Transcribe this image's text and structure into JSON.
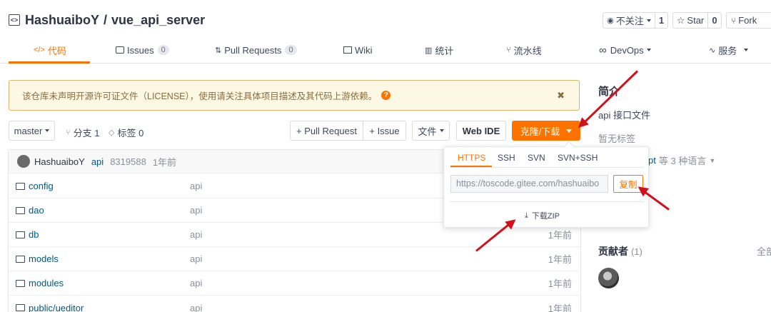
{
  "repo": {
    "owner": "HashuaiboY",
    "separator": "/",
    "name": "vue_api_server",
    "watch_label": "不关注",
    "watch_count": "1",
    "star_label": "Star",
    "star_count": "0",
    "fork_label": "Fork"
  },
  "tabs": [
    {
      "label": "代码",
      "icon": "code-icon"
    },
    {
      "label": "Issues",
      "count": "0",
      "icon": "issues-icon"
    },
    {
      "label": "Pull Requests",
      "count": "0",
      "icon": "pull-request-icon"
    },
    {
      "label": "Wiki",
      "icon": "wiki-icon"
    },
    {
      "label": "统计",
      "icon": "stats-icon"
    },
    {
      "label": "流水线",
      "icon": "pipeline-icon"
    },
    {
      "label": "DevOps",
      "icon": "infinity-icon"
    },
    {
      "label": "服务",
      "icon": "pulse-icon"
    }
  ],
  "notice": {
    "text": "该仓库未声明开源许可证文件（LICENSE），使用请关注具体项目描述及其代码上游依赖。",
    "help": "?",
    "close": "✖"
  },
  "toolbar": {
    "branch": "master",
    "branches": "分支 1",
    "tags": "标签 0",
    "pull_request": "+ Pull Request",
    "issue": "+ Issue",
    "file": "文件",
    "web_ide": "Web IDE",
    "clone": "克隆/下载"
  },
  "commit": {
    "author": "HashuaiboY",
    "message": "api",
    "hash": "8319588",
    "time": "1年前"
  },
  "files": [
    {
      "name": "config",
      "msg": "api",
      "time": ""
    },
    {
      "name": "dao",
      "msg": "api",
      "time": ""
    },
    {
      "name": "db",
      "msg": "api",
      "time": "1年前"
    },
    {
      "name": "models",
      "msg": "api",
      "time": "1年前"
    },
    {
      "name": "modules",
      "msg": "api",
      "time": "1年前"
    },
    {
      "name": "public/ueditor",
      "msg": "api",
      "time": "1年前"
    }
  ],
  "clone_popup": {
    "tabs": [
      "HTTPS",
      "SSH",
      "SVN",
      "SVN+SSH"
    ],
    "url": "https://toscode.gitee.com/hashuaibo",
    "copy": "复制",
    "download": "下载ZIP"
  },
  "sidebar": {
    "intro_title": "简介",
    "description": "api 接口文件",
    "no_tags": "暂无标签",
    "lang_partial": "pt",
    "lang_more": "等 3 种语言",
    "contributors_title": "贡献者",
    "contributors_count": "(1)",
    "all": "全部"
  },
  "colors": {
    "accent": "#fe7300",
    "arrow": "#d0101a",
    "notice_bg": "#fcf8e3",
    "link": "#005980"
  }
}
